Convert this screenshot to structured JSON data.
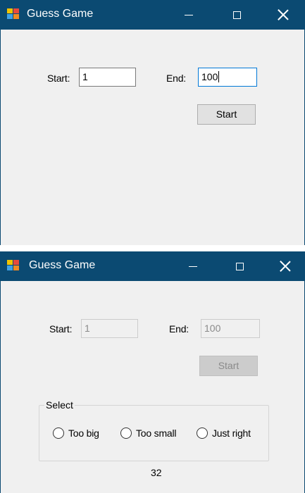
{
  "windows": [
    {
      "title": "Guess Game",
      "start_label": "Start:",
      "start_value": "1",
      "end_label": "End:",
      "end_value": "100",
      "start_button": "Start"
    },
    {
      "title": "Guess Game",
      "start_label": "Start:",
      "start_value": "1",
      "end_label": "End:",
      "end_value": "100",
      "start_button": "Start",
      "group_title": "Select",
      "options": [
        "Too big",
        "Too small",
        "Just right"
      ],
      "result": "32"
    }
  ],
  "icons": {
    "app": "app-window-icon",
    "minimize": "minimize-icon",
    "maximize": "maximize-icon",
    "close": "close-icon"
  },
  "colors": {
    "titlebar": "#0b4a72",
    "window_bg": "#f0f0f0",
    "focus_border": "#0078d7"
  }
}
